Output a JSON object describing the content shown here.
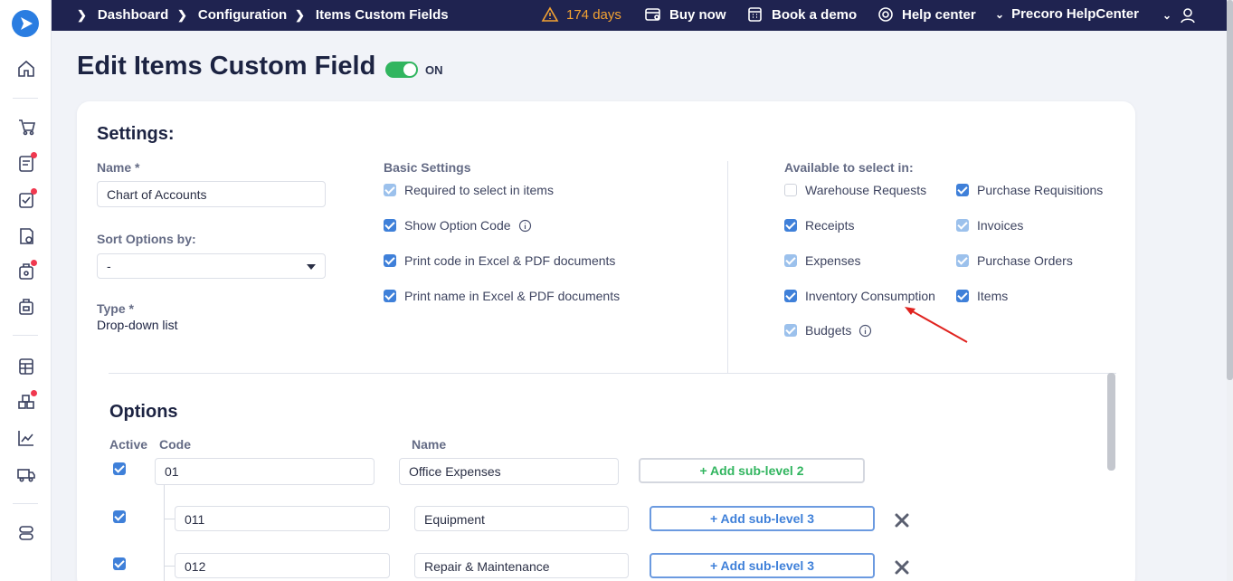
{
  "breadcrumbs": [
    "Dashboard",
    "Configuration",
    "Items Custom Fields"
  ],
  "topbar": {
    "trial": "174 days",
    "buy_now": "Buy now",
    "book_demo": "Book a demo",
    "help_center": "Help center",
    "workspace": "Precoro HelpCenter"
  },
  "page": {
    "title": "Edit Items Custom Field",
    "toggle_label": "ON"
  },
  "settings": {
    "title": "Settings:",
    "name_label": "Name *",
    "name_value": "Chart of Accounts",
    "sort_label": "Sort Options by:",
    "sort_value": "-",
    "type_label": "Type *",
    "type_value": "Drop-down list",
    "basic_label": "Basic Settings",
    "basic": [
      {
        "label": "Required to select in items",
        "state": "dim"
      },
      {
        "label": "Show Option Code",
        "state": "on"
      },
      {
        "label": "Print code in Excel & PDF documents",
        "state": "on"
      },
      {
        "label": "Print name in Excel & PDF documents",
        "state": "on"
      }
    ],
    "available_label": "Available to select in:",
    "available": [
      {
        "label": "Warehouse Requests",
        "state": "off"
      },
      {
        "label": "Purchase Requisitions",
        "state": "on"
      },
      {
        "label": "Receipts",
        "state": "on"
      },
      {
        "label": "Invoices",
        "state": "dim"
      },
      {
        "label": "Expenses",
        "state": "dim"
      },
      {
        "label": "Purchase Orders",
        "state": "dim"
      },
      {
        "label": "Inventory Consumption",
        "state": "on"
      },
      {
        "label": "Items",
        "state": "on"
      },
      {
        "label": "Budgets",
        "state": "dim"
      }
    ]
  },
  "options": {
    "title": "Options",
    "headers": {
      "active": "Active",
      "code": "Code",
      "name": "Name"
    },
    "rows": [
      {
        "code": "01",
        "name": "Office Expenses",
        "button": "+ Add sub-level 2"
      },
      {
        "code": "011",
        "name": "Equipment",
        "button": "+ Add sub-level 3"
      },
      {
        "code": "012",
        "name": "Repair & Maintenance",
        "button": "+ Add sub-level 3"
      }
    ]
  },
  "colors": {
    "topbar": "#1f2350",
    "accent_blue": "#3f80d9",
    "accent_green": "#31b55f",
    "warning": "#f3a232",
    "annotation_arrow": "#e0231f"
  }
}
